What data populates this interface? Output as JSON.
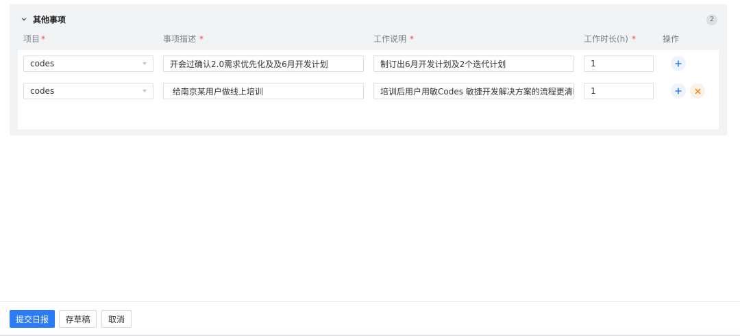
{
  "section": {
    "title": "其他事项",
    "count": "2",
    "collapse_icon": "chevron-down-icon"
  },
  "columns": {
    "project": "项目",
    "description": "事项描述",
    "work_note": "工作说明",
    "hours": "工作时长(h)",
    "actions": "操作",
    "required_mark": "*"
  },
  "rows": [
    {
      "project": "codes",
      "description": "开会过确认2.0需求优先化及及6月开发计划",
      "work_note": "制订出6月开发计划及2个迭代计划",
      "hours": "1",
      "actions": [
        "add-icon"
      ]
    },
    {
      "project": "codes",
      "description": " 给南京某用户做线上培训",
      "work_note": "培训后用户用敏Codes 敏捷开发解决方案的流程更清晰",
      "hours": "1",
      "actions": [
        "add-icon",
        "close-icon"
      ]
    }
  ],
  "footer": {
    "submit_label": "提交日报",
    "draft_label": "存草稿",
    "cancel_label": "取消"
  },
  "colors": {
    "primary": "#2b7cf6",
    "required": "#e5484d",
    "delete": "#f08c2e",
    "panel_bg": "#f2f3f5"
  }
}
